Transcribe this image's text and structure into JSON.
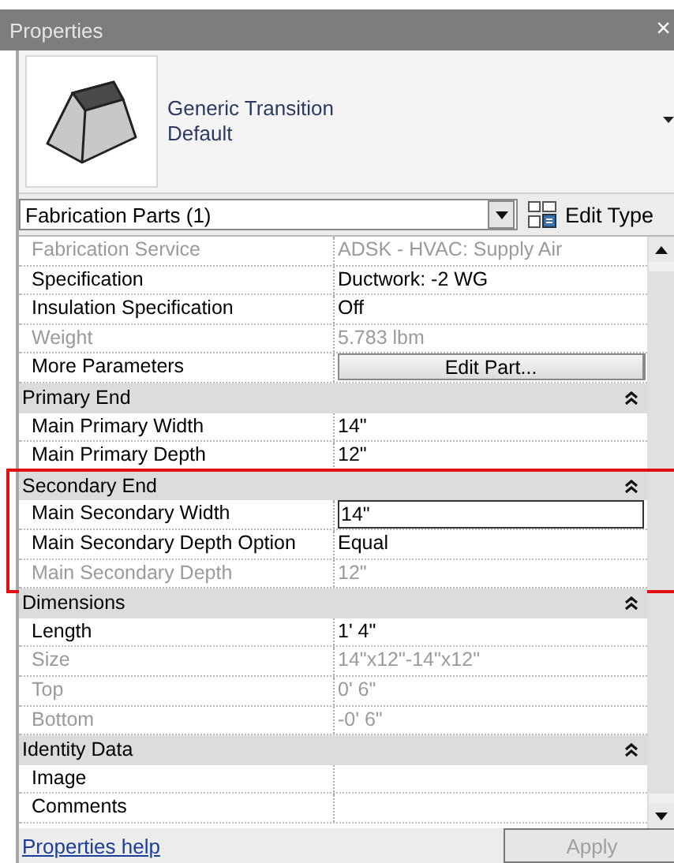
{
  "window": {
    "title": "Properties",
    "close": "×"
  },
  "type_selector": {
    "family": "Generic Transition",
    "type": "Default"
  },
  "filter": {
    "value": "Fabrication Parts (1)"
  },
  "edit_type": {
    "label": "Edit Type"
  },
  "groups": [
    {
      "rows": [
        {
          "kind": "text",
          "name": "Fabrication Service",
          "value": "ADSK - HVAC: Supply Air",
          "disabled": true
        },
        {
          "kind": "text",
          "name": "Specification",
          "value": "Ductwork: -2 WG",
          "disabled": false
        },
        {
          "kind": "text",
          "name": "Insulation Specification",
          "value": "Off",
          "disabled": false
        },
        {
          "kind": "text",
          "name": "Weight",
          "value": "5.783 lbm",
          "disabled": true
        },
        {
          "kind": "button",
          "name": "More Parameters",
          "value": "Edit Part...",
          "disabled": false
        }
      ]
    },
    {
      "title": "Primary End",
      "expanded": true,
      "highlighted": false,
      "rows": [
        {
          "kind": "text",
          "name": "Main Primary Width",
          "value": "14\"",
          "disabled": false
        },
        {
          "kind": "text",
          "name": "Main Primary Depth",
          "value": "12\"",
          "disabled": false
        }
      ]
    },
    {
      "title": "Secondary End",
      "expanded": true,
      "highlighted": true,
      "rows": [
        {
          "kind": "input",
          "name": "Main Secondary Width",
          "value": "14\"",
          "disabled": false
        },
        {
          "kind": "text",
          "name": "Main Secondary Depth Option",
          "value": "Equal",
          "disabled": false
        },
        {
          "kind": "text",
          "name": "Main Secondary Depth",
          "value": "12\"",
          "disabled": true
        }
      ]
    },
    {
      "title": "Dimensions",
      "expanded": true,
      "highlighted": false,
      "rows": [
        {
          "kind": "text",
          "name": "Length",
          "value": "1'  4\"",
          "disabled": false
        },
        {
          "kind": "text",
          "name": "Size",
          "value": "14\"x12\"-14\"x12\"",
          "disabled": true
        },
        {
          "kind": "text",
          "name": "Top",
          "value": "0'  6\"",
          "disabled": true
        },
        {
          "kind": "text",
          "name": "Bottom",
          "value": "-0'  6\"",
          "disabled": true
        }
      ]
    },
    {
      "title": "Identity Data",
      "expanded": true,
      "highlighted": false,
      "rows": [
        {
          "kind": "text",
          "name": "Image",
          "value": "",
          "disabled": false
        },
        {
          "kind": "text",
          "name": "Comments",
          "value": "",
          "disabled": false
        }
      ]
    }
  ],
  "footer": {
    "help_link": "Properties help",
    "apply": {
      "label": "Apply",
      "disabled": true
    }
  }
}
